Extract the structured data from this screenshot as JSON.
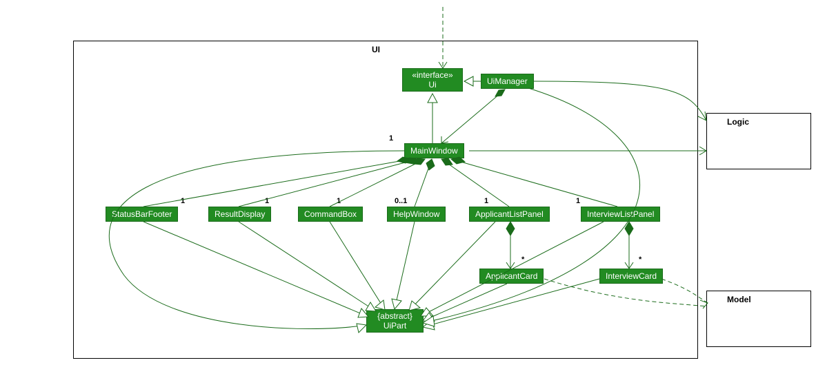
{
  "packages": {
    "ui": {
      "label": "UI"
    },
    "logic": {
      "label": "Logic"
    },
    "model": {
      "label": "Model"
    }
  },
  "classes": {
    "ui_interface": {
      "stereotype": "«interface»",
      "name": "Ui"
    },
    "uimanager": {
      "name": "UiManager"
    },
    "mainwindow": {
      "name": "MainWindow"
    },
    "statusbarfooter": {
      "name": "StatusBarFooter"
    },
    "resultdisplay": {
      "name": "ResultDisplay"
    },
    "commandbox": {
      "name": "CommandBox"
    },
    "helpwindow": {
      "name": "HelpWindow"
    },
    "applicantlistpanel": {
      "name": "ApplicantListPanel"
    },
    "interviewlistpanel": {
      "name": "InterviewListPanel"
    },
    "applicantcard": {
      "name": "ApplicantCard"
    },
    "interviewcard": {
      "name": "InterviewCard"
    },
    "uipart": {
      "stereotype": "{abstract}",
      "name": "UiPart"
    }
  },
  "multiplicities": {
    "mainwindow": "1",
    "statusbarfooter": "1",
    "resultdisplay": "1",
    "commandbox": "1",
    "helpwindow": "0..1",
    "applicantlistpanel": "1",
    "interviewlistpanel": "1",
    "applicantcard": "*",
    "interviewcard": "*"
  }
}
